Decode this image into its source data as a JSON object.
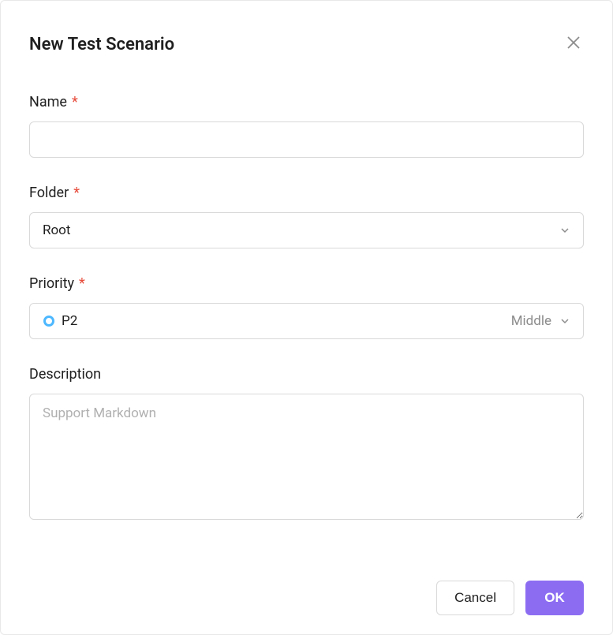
{
  "dialog": {
    "title": "New Test Scenario"
  },
  "fields": {
    "name": {
      "label": "Name",
      "required": "*",
      "value": ""
    },
    "folder": {
      "label": "Folder",
      "required": "*",
      "value": "Root"
    },
    "priority": {
      "label": "Priority",
      "required": "*",
      "value": "P2",
      "suffix": "Middle"
    },
    "description": {
      "label": "Description",
      "placeholder": "Support Markdown",
      "value": ""
    }
  },
  "actions": {
    "cancel": "Cancel",
    "ok": "OK"
  }
}
